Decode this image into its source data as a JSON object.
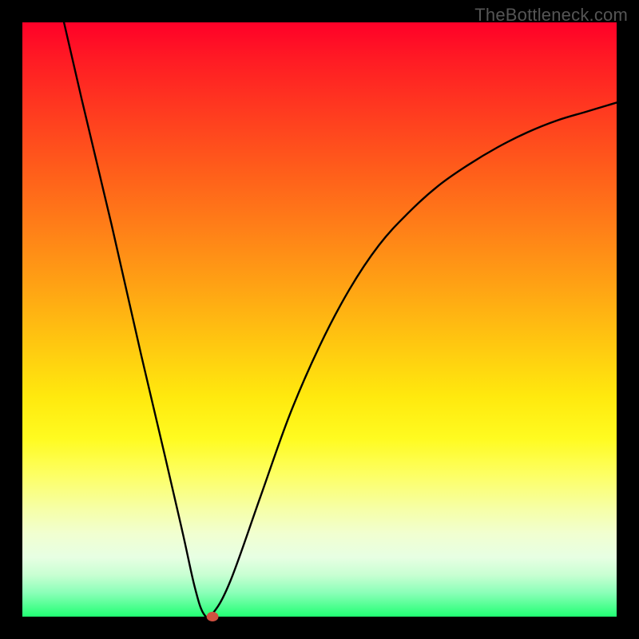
{
  "watermark": "TheBottleneck.com",
  "chart_data": {
    "type": "line",
    "title": "",
    "xlabel": "",
    "ylabel": "",
    "xlim": [
      0,
      100
    ],
    "ylim": [
      0,
      100
    ],
    "grid": false,
    "gradient_stops": [
      {
        "pos": 0,
        "color": "#ff0028"
      },
      {
        "pos": 6,
        "color": "#ff1a24"
      },
      {
        "pos": 14,
        "color": "#ff3720"
      },
      {
        "pos": 24,
        "color": "#ff5a1b"
      },
      {
        "pos": 34,
        "color": "#ff7d18"
      },
      {
        "pos": 44,
        "color": "#ffa114"
      },
      {
        "pos": 54,
        "color": "#ffc710"
      },
      {
        "pos": 63,
        "color": "#ffe90e"
      },
      {
        "pos": 70,
        "color": "#fffb20"
      },
      {
        "pos": 76,
        "color": "#fdff62"
      },
      {
        "pos": 82,
        "color": "#f6ffa8"
      },
      {
        "pos": 86,
        "color": "#f1ffd0"
      },
      {
        "pos": 90,
        "color": "#e7ffe3"
      },
      {
        "pos": 93,
        "color": "#c8ffd2"
      },
      {
        "pos": 96,
        "color": "#8affb8"
      },
      {
        "pos": 100,
        "color": "#21ff73"
      }
    ],
    "series": [
      {
        "name": "curve",
        "x": [
          7,
          10,
          15,
          20,
          24,
          27,
          29,
          30.5,
          32,
          35,
          40,
          45,
          50,
          55,
          60,
          65,
          70,
          75,
          80,
          85,
          90,
          95,
          100
        ],
        "values": [
          100,
          87,
          66,
          44,
          27,
          14,
          5,
          0.5,
          0.5,
          6,
          20,
          34,
          45.5,
          55,
          62.5,
          68,
          72.5,
          76,
          79,
          81.5,
          83.5,
          85,
          86.5
        ]
      }
    ],
    "marker": {
      "x": 32.0,
      "y": 0.0,
      "color": "#d05040",
      "rx": 1.0,
      "ry": 0.8
    },
    "notes": "V-shaped curve; minimum at roughly x≈31 where value ≈0. Left branch rises steeply to 100 at x≈7, right branch rises with diminishing slope toward ~86 at x=100. Axis values are unlabeled in source image; x and y scaled 0–100."
  }
}
